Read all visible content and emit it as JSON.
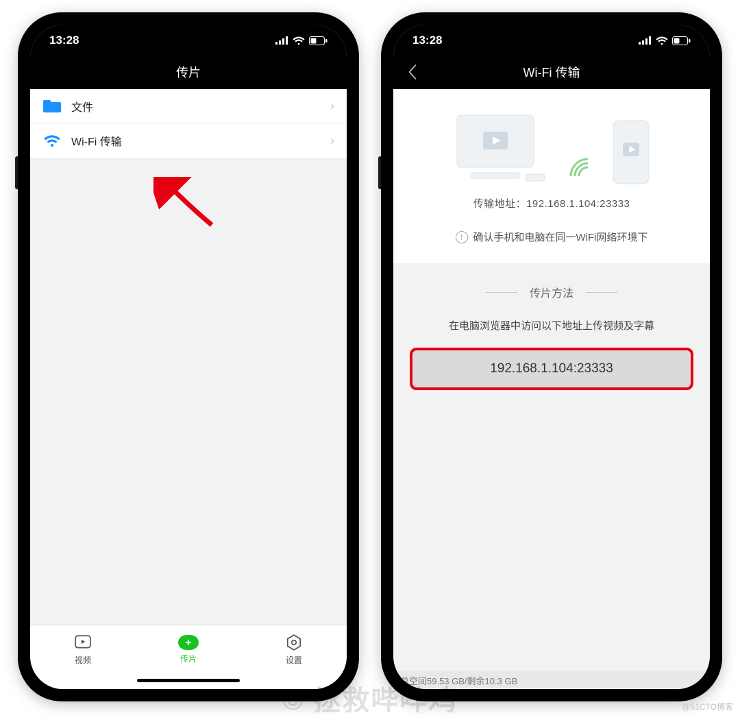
{
  "statusbar": {
    "time": "13:28"
  },
  "left": {
    "title": "传片",
    "items": [
      {
        "label": "文件",
        "icon": "folder"
      },
      {
        "label": "Wi-Fi 传输",
        "icon": "wifi"
      }
    ],
    "tabs": [
      {
        "label": "视频"
      },
      {
        "label": "传片"
      },
      {
        "label": "设置"
      }
    ]
  },
  "right": {
    "title": "Wi-Fi 传输",
    "address_label": "传输地址：",
    "address_value": "192.168.1.104:23333",
    "notice": "确认手机和电脑在同一WiFi网络环境下",
    "method_title": "传片方法",
    "method_desc": "在电脑浏览器中访问以下地址上传视频及字幕",
    "address_box": "192.168.1.104:23333",
    "storage": "总空间59.53 GB/剩余10.3 GB"
  },
  "watermark": "© 拯救哔哔鸡",
  "watermark_small": "@51CTO博客"
}
